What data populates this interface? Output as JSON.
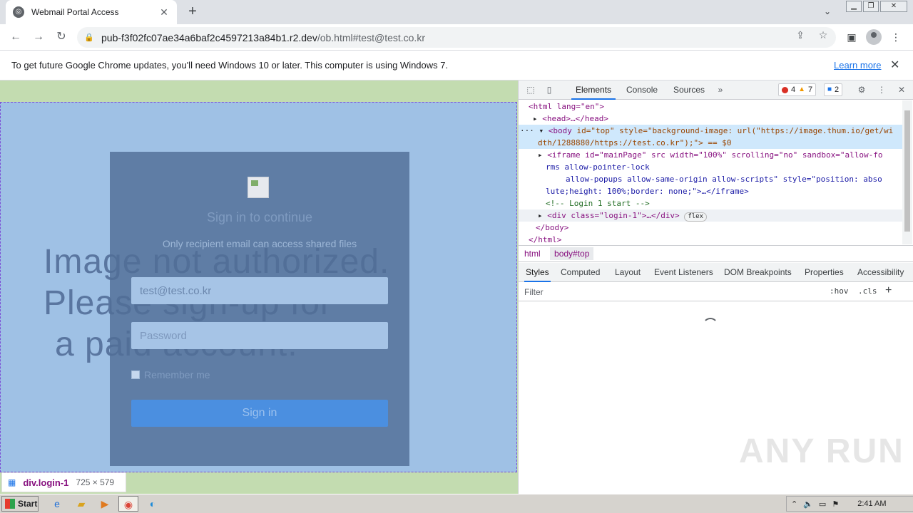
{
  "browser": {
    "tab_title": "Webmail Portal Access",
    "url_host": "pub-f3f02fc07ae34a6baf2c4597213a84b1.r2.dev",
    "url_path": "/ob.html#test@test.co.kr"
  },
  "infobar": {
    "message": "To get future Google Chrome updates, you'll need Windows 10 or later. This computer is using Windows 7.",
    "learn_more": "Learn more"
  },
  "page": {
    "background_text": [
      "Image not authorized.",
      "Please sign-up for",
      "a paid account."
    ],
    "login": {
      "heading": "Sign in to continue",
      "subheading": "Only recipient email can access shared files",
      "email_value": "test@test.co.kr",
      "password_placeholder": "Password",
      "remember_label": "Remember me",
      "signin_label": "Sign in"
    },
    "inspect_tooltip": {
      "selector": "div.login-1",
      "dimensions": "725 × 579"
    }
  },
  "devtools": {
    "tabs": [
      "Elements",
      "Console",
      "Sources"
    ],
    "errors": "4",
    "warnings": "7",
    "messages": "2",
    "dom_lines": {
      "l1_tag": "<html lang=\"en\">",
      "l2_tag": "<head>…</head>",
      "l3a": "<body ",
      "l3b": "id=\"top\" style=\"background-image: url(\"https://image.thum.io/get/wi",
      "l4": "dth/1288880/https://test.co.kr\");\"> == $0",
      "l5": "<iframe id=\"mainPage\" src width=\"100%\" scrolling=\"no\" sandbox=\"allow-fo",
      "l6": "rms allow-pointer-lock",
      "l7": "allow-popups allow-same-origin allow-scripts\" style=\"position: abso",
      "l8": "lute;height: 100%;border: none;\">…</iframe>",
      "l9": "<!-- Login 1 start -->",
      "l10": "<div class=\"login-1\">…</div>",
      "l10_badge": "flex",
      "l11": "</body>",
      "l12": "</html>"
    },
    "breadcrumbs": [
      "html",
      "body#top"
    ],
    "subtabs": [
      "Styles",
      "Computed",
      "Layout",
      "Event Listeners",
      "DOM Breakpoints",
      "Properties",
      "Accessibility"
    ],
    "filter_placeholder": "Filter",
    "hov": ":hov",
    ".cls": ".cls"
  },
  "watermark": "ANY RUN",
  "taskbar": {
    "start_label": "Start",
    "clock": "2:41 AM"
  }
}
